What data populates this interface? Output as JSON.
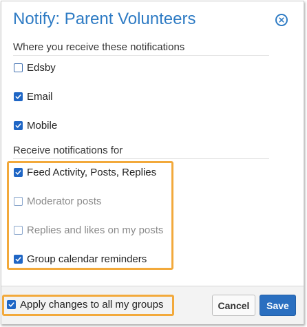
{
  "dialog": {
    "title": "Notify: Parent Volunteers",
    "close_icon": "close-circle-icon"
  },
  "receive_section": {
    "label": "Where you receive these notifications",
    "options": [
      {
        "label": "Edsby",
        "checked": false
      },
      {
        "label": "Email",
        "checked": true
      },
      {
        "label": "Mobile",
        "checked": true
      }
    ]
  },
  "notify_section": {
    "label": "Receive notifications for",
    "options": [
      {
        "label": "Feed Activity, Posts, Replies",
        "checked": true
      },
      {
        "label": "Moderator posts",
        "checked": false
      },
      {
        "label": "Replies and likes on my posts",
        "checked": false
      },
      {
        "label": "Group calendar reminders",
        "checked": true
      }
    ]
  },
  "footer": {
    "apply_all_label": "Apply changes to all my groups",
    "apply_all_checked": true,
    "cancel_label": "Cancel",
    "save_label": "Save"
  },
  "colors": {
    "accent": "#2e7bc4",
    "checkbox": "#1f66c5",
    "highlight": "#f2a93b",
    "save_button": "#2a6fc0"
  }
}
